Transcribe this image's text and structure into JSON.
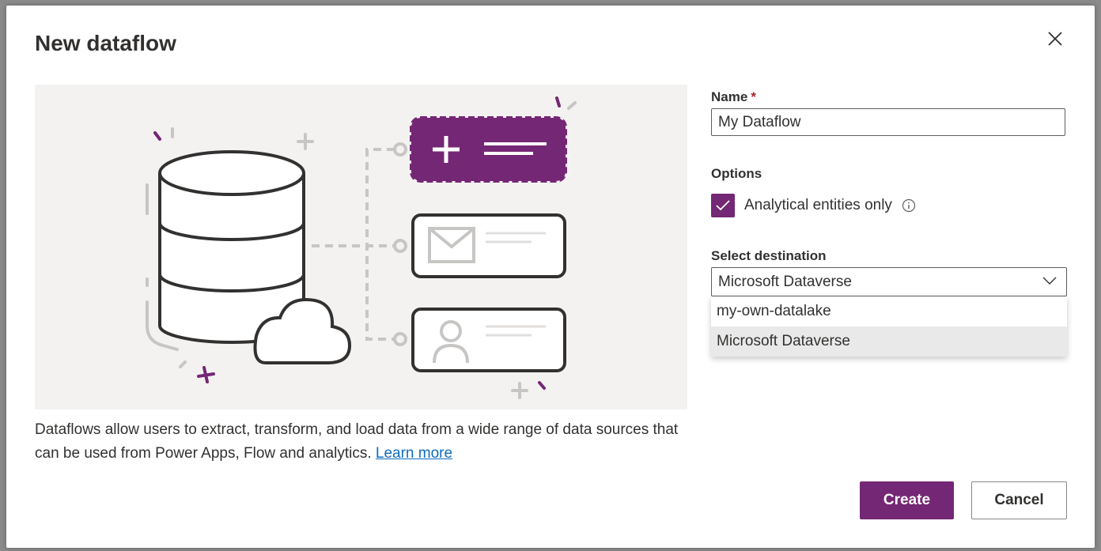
{
  "dialog": {
    "title": "New dataflow",
    "close_icon": "close-icon"
  },
  "description": {
    "text": "Dataflows allow users to extract, transform, and load data from a wide range of data sources that can be used from Power Apps, Flow and analytics.",
    "learn_more": "Learn more"
  },
  "form": {
    "name_label": "Name",
    "required_marker": "*",
    "name_value": "My Dataflow",
    "options_label": "Options",
    "analytical_checkbox": {
      "label": "Analytical entities only",
      "checked": true,
      "info_icon": "info-icon"
    },
    "destination_label": "Select destination",
    "destination_value": "Microsoft Dataverse",
    "destination_options": [
      {
        "label": "my-own-datalake",
        "selected": false
      },
      {
        "label": "Microsoft Dataverse",
        "selected": true
      }
    ]
  },
  "buttons": {
    "create": "Create",
    "cancel": "Cancel"
  },
  "colors": {
    "accent": "#742774",
    "link": "#0f6cbd",
    "required": "#a4262c",
    "illustration_bg": "#f3f2f1"
  }
}
